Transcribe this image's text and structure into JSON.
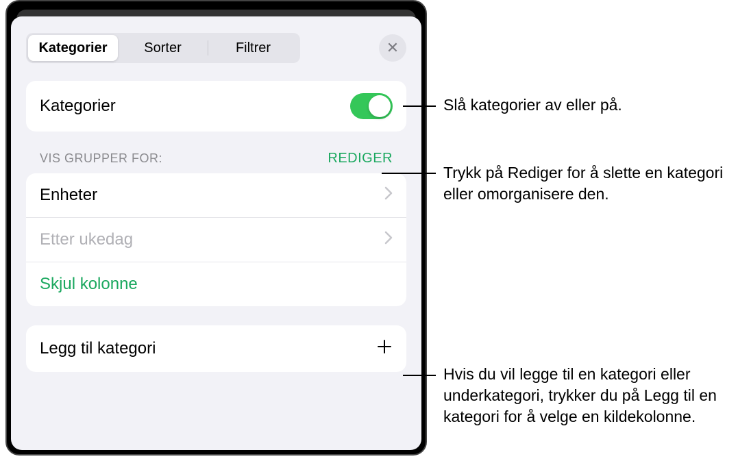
{
  "tabs": {
    "categories": "Kategorier",
    "sort": "Sorter",
    "filter": "Filtrer"
  },
  "close_label": "✕",
  "toggle_section": {
    "label": "Kategorier"
  },
  "groups": {
    "header": "VIS GRUPPER FOR:",
    "edit": "REDIGER",
    "item1": "Enheter",
    "item2": "Etter ukedag",
    "hide": "Skjul kolonne"
  },
  "add_category": "Legg til kategori",
  "callouts": {
    "toggle": "Slå kategorier av eller på.",
    "edit": "Trykk på Rediger for å slette en kategori eller omorganisere den.",
    "add": "Hvis du vil legge til en kategori eller underkategori, trykker du på Legg til en kategori for å velge en kildekolonne."
  }
}
